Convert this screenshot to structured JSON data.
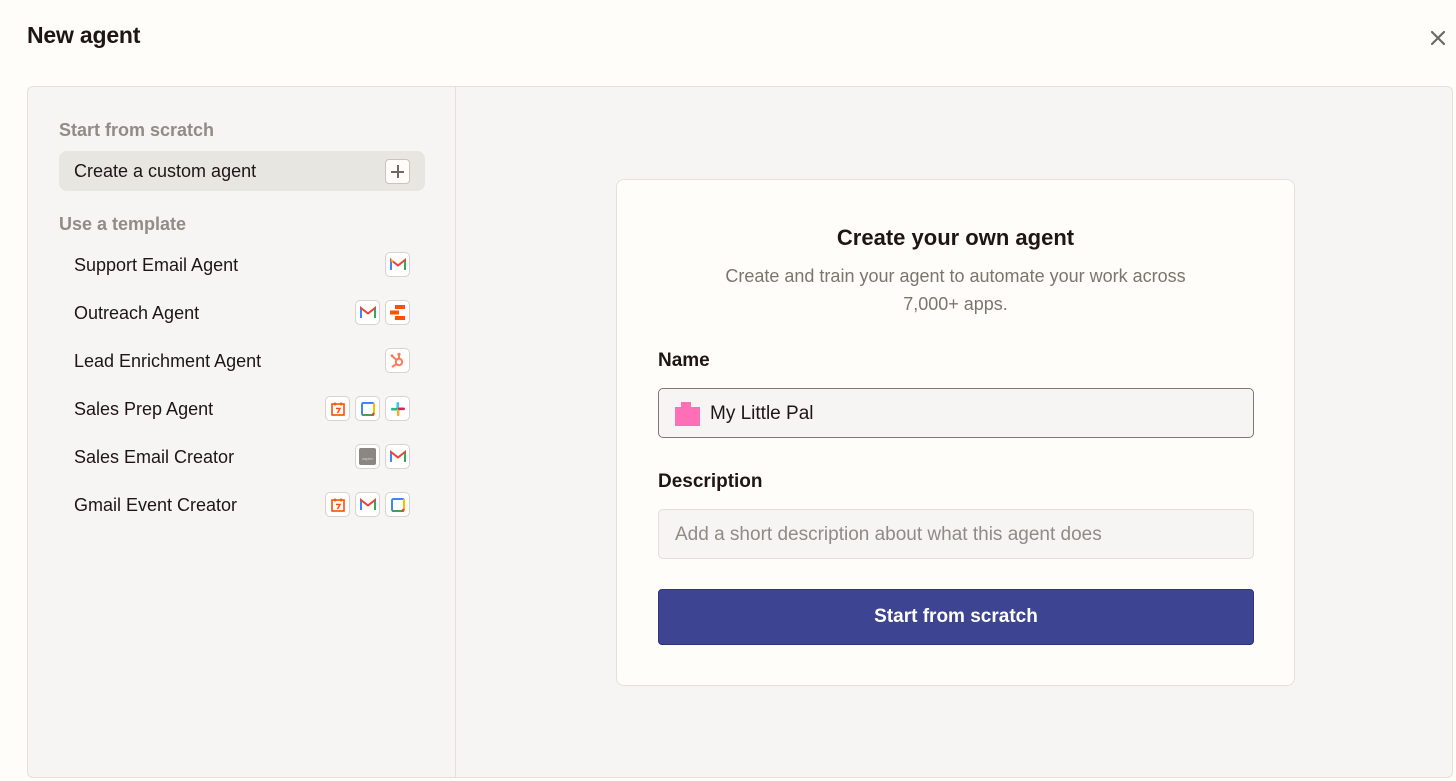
{
  "dialog": {
    "title": "New agent"
  },
  "sidebar": {
    "scratch_heading": "Start from scratch",
    "custom_item_label": "Create a custom agent",
    "template_heading": "Use a template",
    "templates": [
      {
        "label": "Support Email Agent",
        "icons": [
          "gmail-icon"
        ]
      },
      {
        "label": "Outreach Agent",
        "icons": [
          "gmail-icon",
          "stacked-bars-icon"
        ]
      },
      {
        "label": "Lead Enrichment Agent",
        "icons": [
          "hubspot-icon"
        ]
      },
      {
        "label": "Sales Prep Agent",
        "icons": [
          "calendar-icon",
          "google-calendar-icon",
          "slack-icon"
        ]
      },
      {
        "label": "Sales Email Creator",
        "icons": [
          "zapier-icon",
          "gmail-icon"
        ]
      },
      {
        "label": "Gmail Event Creator",
        "icons": [
          "calendar-icon",
          "gmail-icon",
          "google-calendar-icon"
        ]
      }
    ]
  },
  "card": {
    "title": "Create your own agent",
    "subtitle": "Create and train your agent to automate your work across 7,000+ apps.",
    "name_label": "Name",
    "name_value": "My Little Pal",
    "description_label": "Description",
    "description_placeholder": "Add a short description about what this agent does",
    "submit_label": "Start from scratch"
  },
  "colors": {
    "accent": "#3d4592",
    "avatar": "#ff6fb5"
  }
}
